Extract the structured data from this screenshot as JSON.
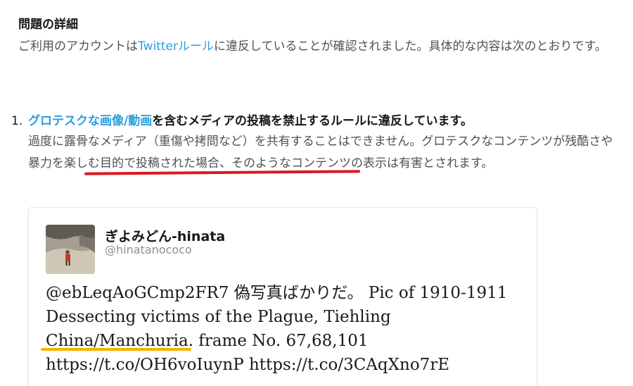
{
  "heading": "問題の詳細",
  "intro": {
    "before": "ご利用のアカウントは",
    "link": "Twitterルール",
    "after": "に違反していることが確認されました。具体的な内容は次のとおりです。"
  },
  "violation": {
    "number": "1.",
    "link": "グロテスクな画像/動画",
    "title_rest": "を含むメディアの投稿を禁止するルールに違反しています。",
    "description": "過度に露骨なメディア（重傷や拷問など）を共有することはできません。グロテスクなコンテンツが残酷さや暴力を楽しむ目的で投稿された場合、そのようなコンテンツの表示は有害とされます。"
  },
  "tweet": {
    "display_name": "ぎよみどん-hinata",
    "screen_name": "@hinatanococo",
    "text": "@ebLeqAoGCmp2FR7 偽写真ばかりだ。 Pic of 1910-1911 Dessecting victims of the Plague, Tiehling China/Manchuria. frame No. 67,68,101 https://t.co/OH6voIuynP https://t.co/3CAqXno7rE"
  },
  "colors": {
    "link": "#2b9fe0",
    "red_underline": "#d9191f",
    "yellow_underline": "#f2b400"
  }
}
